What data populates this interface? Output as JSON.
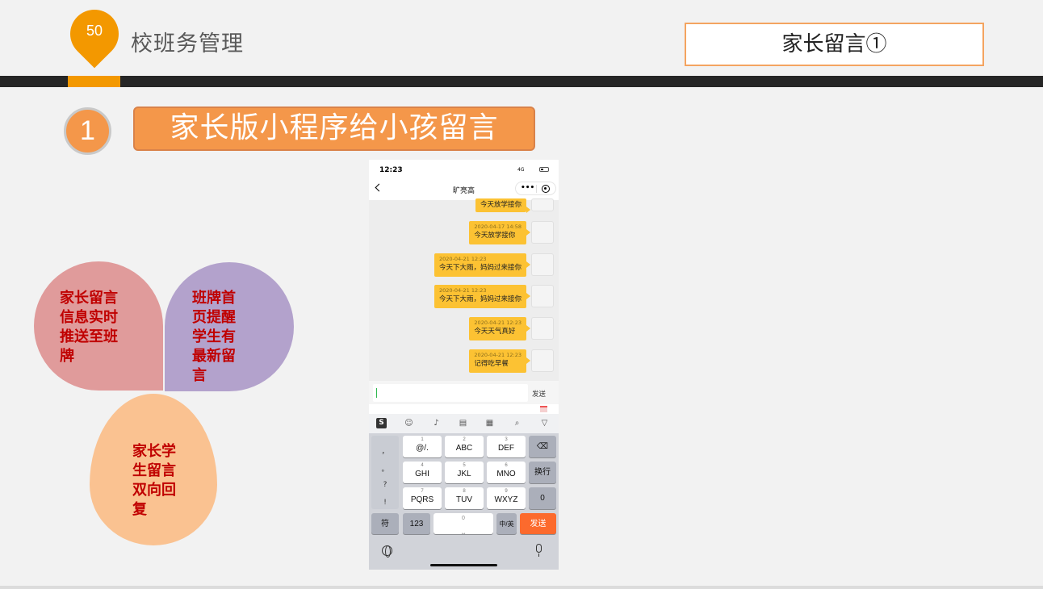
{
  "header": {
    "page_number": "50",
    "section_title": "校班务管理",
    "slide_title": "家长留言①"
  },
  "subtitle": {
    "step": "1",
    "text": "家长版小程序给小孩留言"
  },
  "features": [
    {
      "text": "家长留言\n信息实时\n推送至班\n牌"
    },
    {
      "text": "班牌首\n页提醒\n学生有\n最新留\n言"
    },
    {
      "text": "家长学\n生留言\n双向回\n复"
    }
  ],
  "phone": {
    "status": {
      "time": "12:23",
      "network": "4G"
    },
    "nav": {
      "title": "旷亮高",
      "menu": "•••"
    },
    "messages": [
      {
        "time": "",
        "text": "今天放学接你"
      },
      {
        "time": "2020-04-17 14:58",
        "text": "今天放学接你"
      },
      {
        "time": "2020-04-21 12:23",
        "text": "今天下大雨，妈妈过来接你"
      },
      {
        "time": "2020-04-21 12:23",
        "text": "今天下大雨，妈妈过来接你"
      },
      {
        "time": "2020-04-21 12:23",
        "text": "今天天气真好"
      },
      {
        "time": "2020-04-21 12:23",
        "text": "记得吃早餐"
      }
    ],
    "input": {
      "send_label": "发送"
    },
    "keyboard": {
      "symbols": [
        "，",
        "。",
        "?",
        "!"
      ],
      "rows": [
        [
          {
            "num": "1",
            "main": "@/."
          },
          {
            "num": "2",
            "main": "ABC"
          },
          {
            "num": "3",
            "main": "DEF"
          }
        ],
        [
          {
            "num": "4",
            "main": "GHI"
          },
          {
            "num": "5",
            "main": "JKL"
          },
          {
            "num": "6",
            "main": "MNO"
          }
        ],
        [
          {
            "num": "7",
            "main": "PQRS"
          },
          {
            "num": "8",
            "main": "TUV"
          },
          {
            "num": "9",
            "main": "WXYZ"
          }
        ]
      ],
      "delete_label": "⌫",
      "enter_label": "换行",
      "zero_label": "0",
      "symbol_key": "符",
      "num_key": "123",
      "space_hint": "0",
      "lang_key": "中/英",
      "send_key": "发送"
    }
  }
}
